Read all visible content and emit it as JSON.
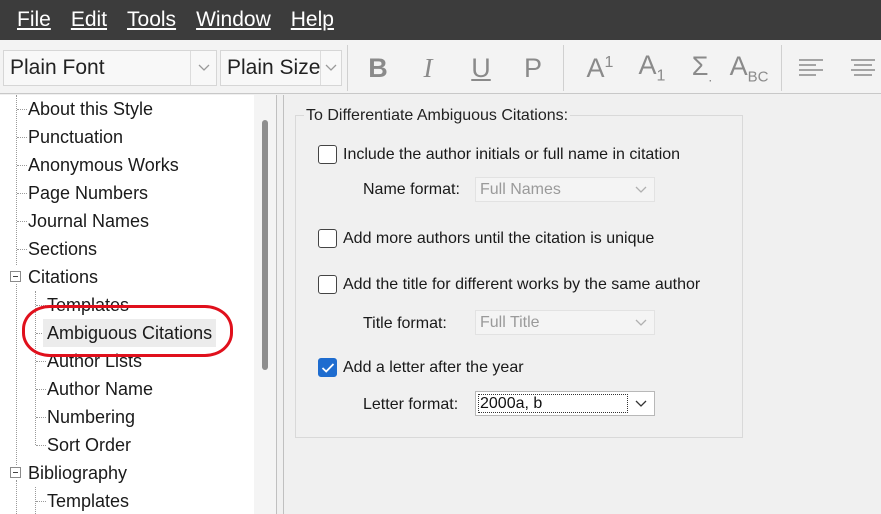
{
  "menu": [
    "File",
    "Edit",
    "Tools",
    "Window",
    "Help"
  ],
  "toolbar": {
    "font_value": "Plain Font",
    "size_value": "Plain Size",
    "bold": "B",
    "italic": "I",
    "underline": "U",
    "plain": "P",
    "superscript": "A",
    "superscript_sub": "1",
    "subscript": "A",
    "subscript_sub": "1",
    "symbol": "Σ",
    "smallcaps": "A",
    "smallcaps_sub": "BC"
  },
  "tree": {
    "items": [
      "About this Style",
      "Punctuation",
      "Anonymous Works",
      "Page Numbers",
      "Journal Names",
      "Sections",
      "Citations",
      "Templates",
      "Ambiguous Citations",
      "Author Lists",
      "Author Name",
      "Numbering",
      "Sort Order",
      "Bibliography",
      "Templates"
    ],
    "selected": "Ambiguous Citations"
  },
  "panel": {
    "group_title": "To Differentiate Ambiguous Citations:",
    "opt_initials": {
      "label": "Include the author initials or full name in citation",
      "checked": false
    },
    "name_format": {
      "label": "Name format:",
      "value": "Full Names",
      "enabled": false
    },
    "opt_more_authors": {
      "label": "Add more authors until the citation is unique",
      "checked": false
    },
    "opt_title": {
      "label": "Add the title for different works by the same author",
      "checked": false
    },
    "title_format": {
      "label": "Title format:",
      "value": "Full Title",
      "enabled": false
    },
    "opt_letter": {
      "label": "Add a letter after the year",
      "checked": true
    },
    "letter_format": {
      "label": "Letter format:",
      "value": "2000a, b",
      "enabled": true
    }
  },
  "colors": {
    "menubar_bg": "#3c3c3c",
    "checkbox_checked": "#1e6ccf",
    "highlight_ring": "#e0101c"
  }
}
